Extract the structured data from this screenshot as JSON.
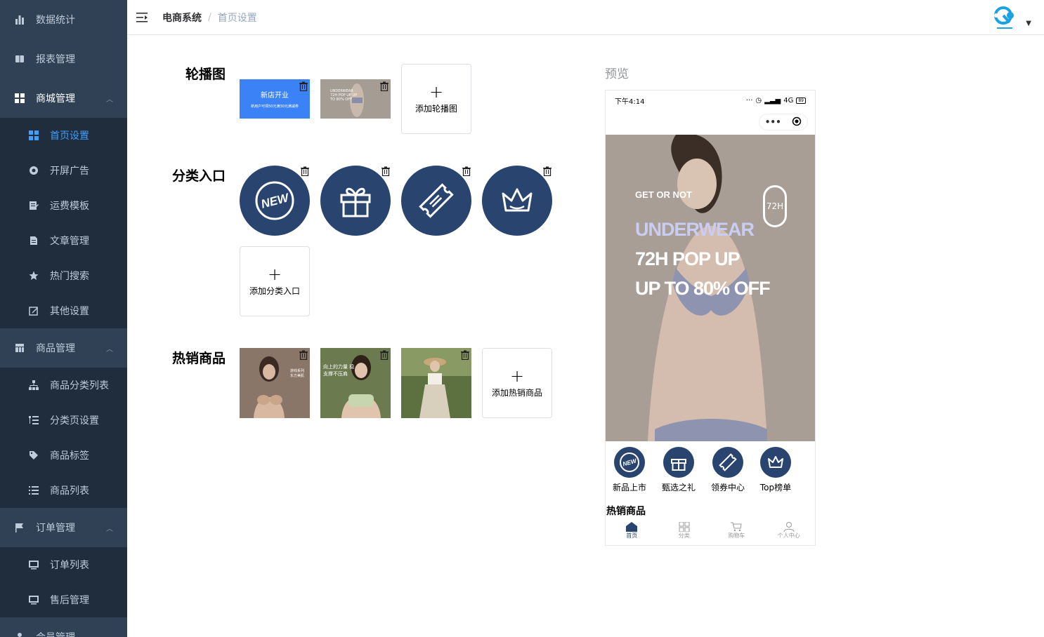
{
  "sidebar": {
    "groups": [
      {
        "label": "数据统计",
        "icon": "bar-chart-icon"
      },
      {
        "label": "报表管理",
        "icon": "report-icon"
      },
      {
        "label": "商城管理",
        "icon": "grid-icon",
        "items": [
          {
            "label": "首页设置",
            "icon": "grid-icon",
            "active": true
          },
          {
            "label": "开屏广告",
            "icon": "aperture-icon"
          },
          {
            "label": "运费模板",
            "icon": "template-icon"
          },
          {
            "label": "文章管理",
            "icon": "document-icon"
          },
          {
            "label": "热门搜索",
            "icon": "star-icon"
          },
          {
            "label": "其他设置",
            "icon": "edit-icon"
          }
        ]
      },
      {
        "label": "商品管理",
        "icon": "table-icon",
        "items": [
          {
            "label": "商品分类列表",
            "icon": "tree-icon"
          },
          {
            "label": "分类页设置",
            "icon": "list-tree-icon"
          },
          {
            "label": "商品标签",
            "icon": "tag-icon"
          },
          {
            "label": "商品列表",
            "icon": "list-icon"
          }
        ]
      },
      {
        "label": "订单管理",
        "icon": "flag-icon",
        "items": [
          {
            "label": "订单列表",
            "icon": "monitor-icon"
          },
          {
            "label": "售后管理",
            "icon": "monitor-icon"
          }
        ]
      },
      {
        "label": "会员管理",
        "icon": "user-icon"
      }
    ]
  },
  "header": {
    "breadcrumb_home": "电商系统",
    "breadcrumb_sep": "/",
    "breadcrumb_current": "首页设置"
  },
  "sections": {
    "carousel_label": "轮播图",
    "carousel_add": "添加轮播图",
    "carousel_items": [
      {
        "title": "新店开业",
        "subtitle": "新用户可领50元满30元满减券"
      },
      {
        "title": "UNDERWEAR 72H POP UP UP TO 80% OFF"
      }
    ],
    "category_label": "分类入口",
    "category_add": "添加分类入口",
    "hot_label": "热销商品",
    "hot_add": "添加热销商品",
    "hot_items": [
      {
        "caption": "游戏系列 东方美肌"
      },
      {
        "caption": "向上的力量 稳支撑不压肩"
      },
      {
        "caption": ""
      }
    ]
  },
  "preview": {
    "title": "预览",
    "status_time": "下午4:14",
    "status_right": "4G",
    "battery": "89",
    "banner": {
      "tag": "GET OR NOT",
      "line1": "UNDERWEAR",
      "line2": "72H POP UP",
      "line3": "UP TO 80% OFF",
      "badge": "72H"
    },
    "categories": [
      "新品上市",
      "甄选之礼",
      "领券中心",
      "Top榜单"
    ],
    "hot_title": "热销商品",
    "tabs": [
      "首页",
      "分类",
      "购物车",
      "个人中心"
    ]
  },
  "colors": {
    "sidebar_bg": "#304156",
    "submenu_bg": "#1f2d3d",
    "accent": "#409eff",
    "category_circle": "#2a4470"
  }
}
